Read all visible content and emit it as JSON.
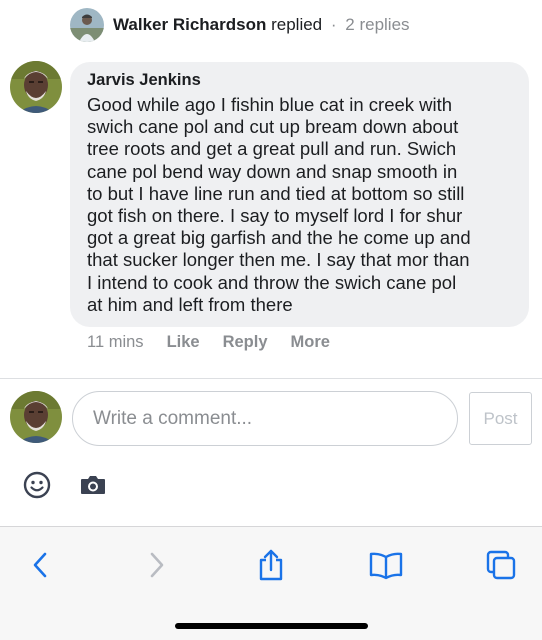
{
  "reply_summary": {
    "name": "Walker Richardson",
    "verb": "replied",
    "separator": "·",
    "count": "2 replies",
    "avatar_icon": "profile-photo-icon"
  },
  "comment": {
    "author": "Jarvis Jenkins",
    "avatar_icon": "profile-photo-icon",
    "lines": [
      "Good while ago I fishin blue cat in creek with",
      "swich cane pol and cut up bream down about",
      "tree roots and get a great pull and run. Swich",
      "cane pol bend way down and snap smooth in",
      "to but I have line run and tied at bottom so still",
      "got fish on there. I say to myself lord I for shur",
      "got a great big garfish and the he come up and",
      "that sucker longer then me. I say that mor than",
      "I intend to cook and throw the swich cane pol",
      "at him and left from there"
    ],
    "bubble_color": "#eff0f2"
  },
  "comment_actions": {
    "time": "11 mins",
    "like": "Like",
    "reply": "Reply",
    "more": "More"
  },
  "composer": {
    "placeholder": "Write a comment...",
    "post_label": "Post",
    "emoji_icon": "emoji-icon",
    "camera_icon": "camera-icon"
  },
  "browser_toolbar": {
    "icons": [
      "back-icon",
      "forward-icon",
      "share-icon",
      "bookmarks-icon",
      "tabs-icon"
    ],
    "accent": "#1a73e8"
  }
}
